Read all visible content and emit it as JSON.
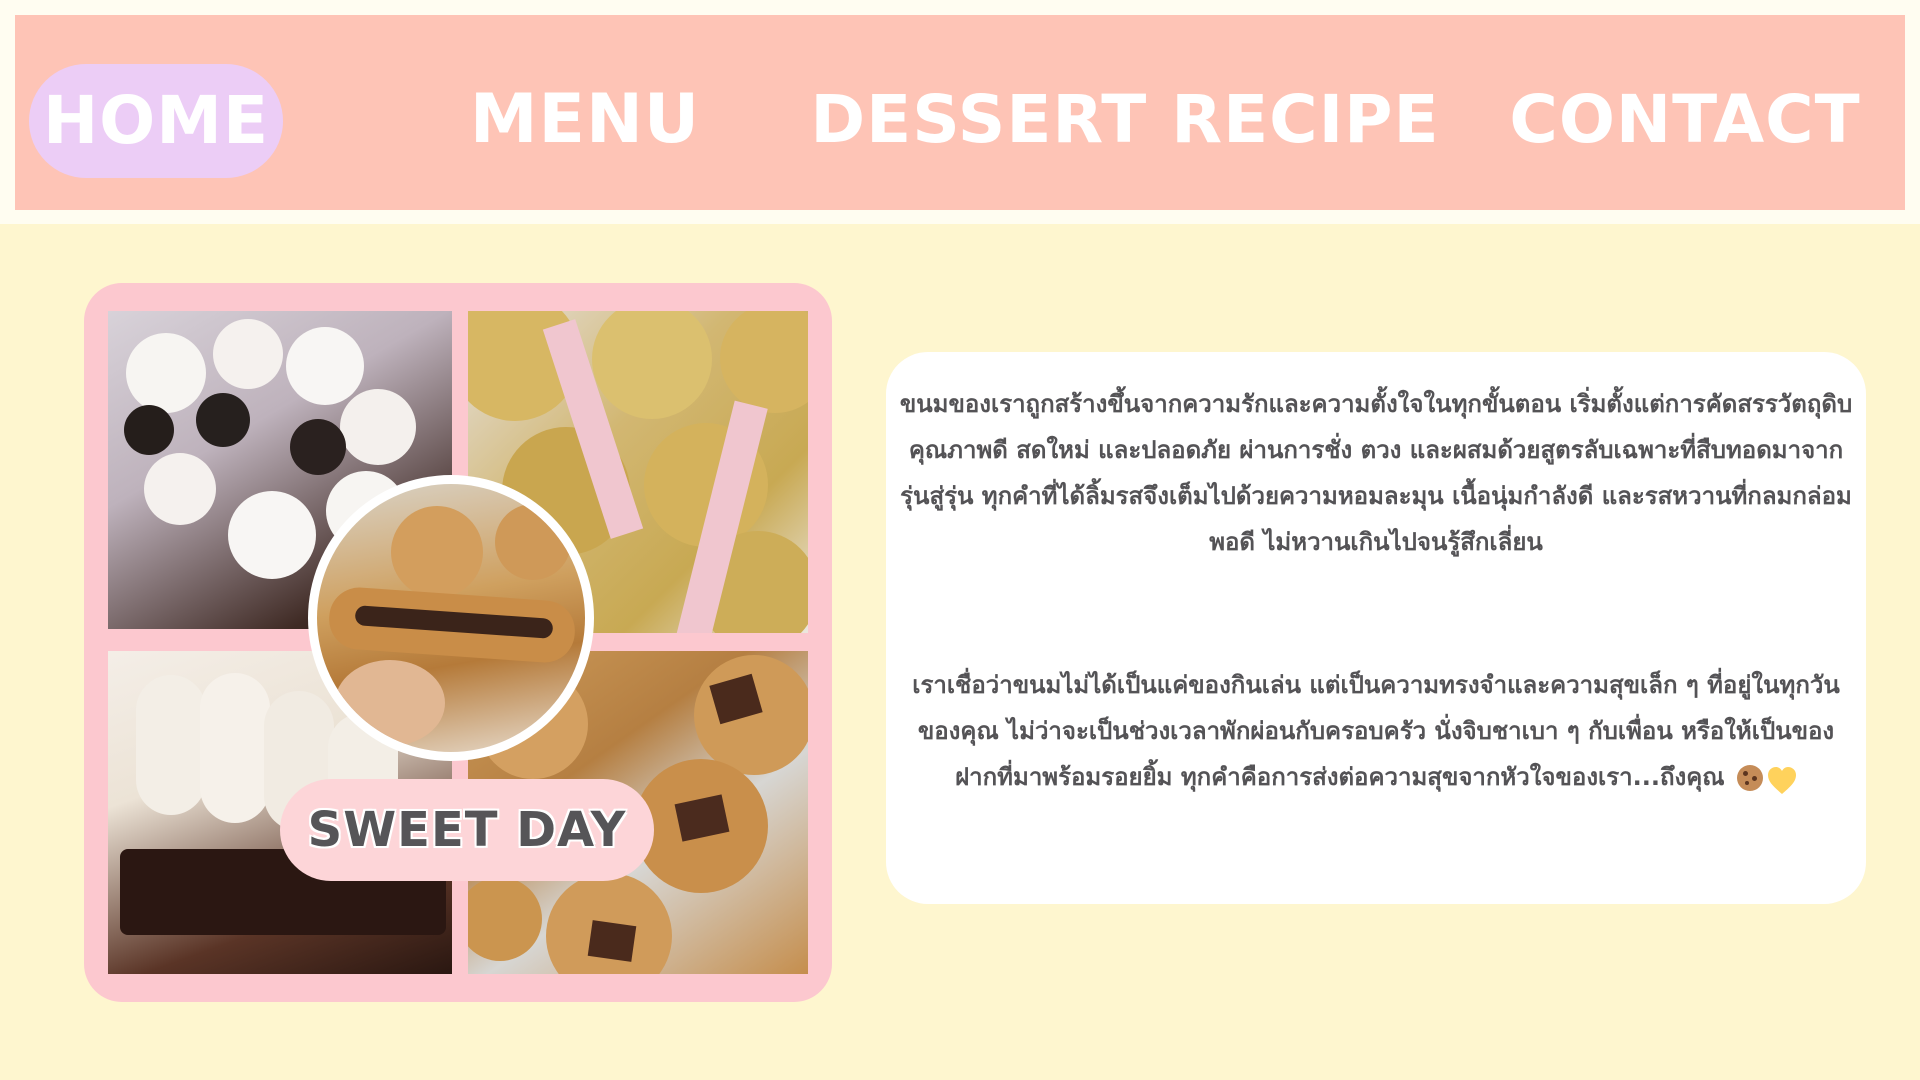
{
  "navbar": {
    "items": [
      {
        "label": "HOME"
      },
      {
        "label": "MENU"
      },
      {
        "label": "DESSERT RECIPE"
      },
      {
        "label": "CONTACT"
      }
    ]
  },
  "collage": {
    "badge_text": "SWEET DAY"
  },
  "intro": {
    "paragraph_1": "ขนมของเราถูกสร้างขึ้นจากความรักและความตั้งใจในทุกขั้นตอน เริ่มตั้งแต่การคัดสรรวัตถุดิบคุณภาพดี สดใหม่ และปลอดภัย ผ่านการชั่ง ตวง และผสมด้วยสูตรลับเฉพาะที่สืบทอดมาจากรุ่นสู่รุ่น ทุกคำที่ได้ลิ้มรสจึงเต็มไปด้วยความหอมละมุน เนื้อนุ่มกำลังดี และรสหวานที่กลมกล่อมพอดี ไม่หวานเกินไปจนรู้สึกเลี่ยน",
    "paragraph_2": "เราเชื่อว่าขนมไม่ได้เป็นแค่ของกินเล่น แต่เป็นความทรงจำและความสุขเล็ก ๆ ที่อยู่ในทุกวันของคุณ ไม่ว่าจะเป็นช่วงเวลาพักผ่อนกับครอบครัว นั่งจิบชาเบา ๆ กับเพื่อน หรือให้เป็นของฝากที่มาพร้อมรอยยิ้ม ทุกคำคือการส่งต่อความสุขจากหัวใจของเรา...ถึงคุณ"
  },
  "colors": {
    "background": "#fef6cf",
    "navbar": "#fec4b6",
    "home_pill": "#eccdf6",
    "collage_frame": "#fcc8cf",
    "card": "#ffffff",
    "text": "#545356"
  },
  "icons": [
    "cookie-emoji-icon",
    "yellow-heart-emoji-icon"
  ]
}
